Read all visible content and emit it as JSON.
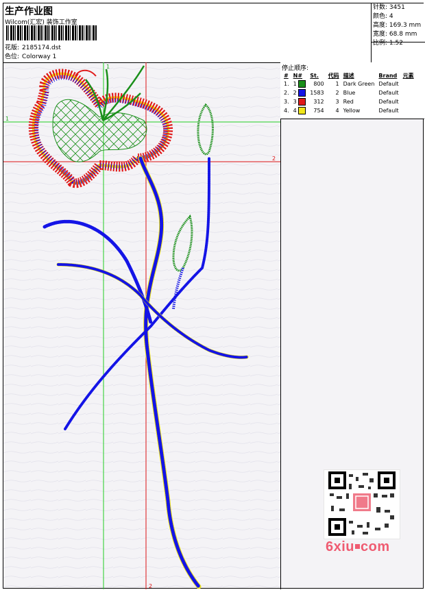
{
  "header": {
    "title": "生产作业图",
    "subtitle": "Wilcom(汇宏) 装饰工作室",
    "design_label": "花版:",
    "design_value": "2185174.dst",
    "colorway_label": "色位:",
    "colorway_value": "Colorway 1"
  },
  "stats": [
    {
      "label": "针数:",
      "value": "3451"
    },
    {
      "label": "颜色:",
      "value": "4"
    },
    {
      "label": "高度:",
      "value": "169.3 mm"
    },
    {
      "label": "宽度:",
      "value": "68.8 mm"
    },
    {
      "label": "比例:",
      "value": "1.52"
    }
  ],
  "stop_sequence": {
    "title": "停止顺序:",
    "columns": [
      "#",
      "N#",
      "St.",
      "代码",
      "描述",
      "Brand",
      "元素"
    ],
    "rows": [
      {
        "index": "1.",
        "n": "1",
        "color": "#1a8f1a",
        "stitches": "800",
        "code": "1",
        "desc": "Dark Green",
        "brand": "Default"
      },
      {
        "index": "2.",
        "n": "2",
        "color": "#1414e6",
        "stitches": "1583",
        "code": "2",
        "desc": "Blue",
        "brand": "Default"
      },
      {
        "index": "3.",
        "n": "3",
        "color": "#e01a1a",
        "stitches": "312",
        "code": "3",
        "desc": "Red",
        "brand": "Default"
      },
      {
        "index": "4.",
        "n": "4",
        "color": "#f0e61a",
        "stitches": "754",
        "code": "4",
        "desc": "Yellow",
        "brand": "Default"
      }
    ]
  },
  "guides": {
    "v1_label": "1",
    "h1_label": "1",
    "h2_label": "2",
    "v2_label": "2"
  },
  "watermark": {
    "text_a": "6xiu",
    "text_b": "com"
  },
  "colors": {
    "green_guide": "#22cc22",
    "red_guide": "#dd1111",
    "thread_blue": "#1414e6",
    "thread_red": "#e01a1a",
    "thread_green": "#1a8f1a",
    "thread_yellow": "#f0e61a"
  }
}
